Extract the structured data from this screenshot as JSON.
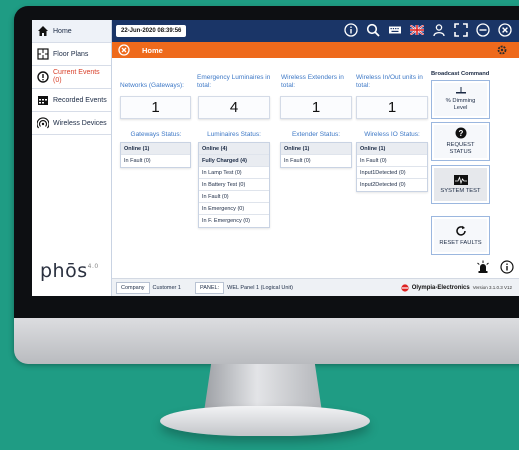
{
  "sidebar": {
    "items": [
      {
        "label": "Home",
        "icon": "home-icon"
      },
      {
        "label": "Floor Plans",
        "icon": "floor-plan-icon"
      },
      {
        "label": "Current Events",
        "sub": "(0)",
        "icon": "alert-icon"
      },
      {
        "label": "Recorded Events",
        "icon": "calendar-icon"
      },
      {
        "label": "Wireless Devices",
        "icon": "wireless-icon"
      }
    ],
    "logo_text": "phōs",
    "logo_version": "4.0"
  },
  "topbar": {
    "datetime": "22-Jun-2020 08:39:56",
    "icons": [
      "info-icon",
      "search-icon",
      "keyboard-icon",
      "uk-flag-icon",
      "user-icon",
      "fullscreen-icon",
      "minus-icon",
      "close-icon"
    ]
  },
  "titlebar": {
    "title": "Home"
  },
  "summary": [
    {
      "label": "Networks (Gateways):",
      "value": "1"
    },
    {
      "label": "Emergency Luminaires in total:",
      "value": "4"
    },
    {
      "label": "Wireless Extenders in total:",
      "value": "1"
    },
    {
      "label": "Wireless In/Out units in total:",
      "value": "1"
    }
  ],
  "status": {
    "gateways": {
      "title": "Gateways Status:",
      "rows": [
        "Online  (1)",
        "In Fault  (0)"
      ]
    },
    "luminaires": {
      "title": "Luminaires Status:",
      "rows": [
        "Online  (4)",
        "Fully Charged  (4)",
        "In Lamp Test  (0)",
        "In Battery Test  (0)",
        "In Fault  (0)",
        "In Emergency  (0)",
        "In F. Emergency  (0)"
      ]
    },
    "extender": {
      "title": "Extender Status:",
      "rows": [
        "Online  (1)",
        "In Fault  (0)"
      ]
    },
    "wireless_io": {
      "title": "Wireless IO Status:",
      "rows": [
        "Online  (1)",
        "In Fault  (0)",
        "Input1Detected  (0)",
        "Input2Detected  (0)"
      ]
    }
  },
  "broadcast": {
    "title": "Broadcast Command",
    "dimming": {
      "line1": "% Dimming",
      "line2": "Level"
    },
    "request": {
      "line1": "REQUEST",
      "line2": "STATUS"
    },
    "system_test": "SYSTEM TEST",
    "reset_faults": "RESET FAULTS"
  },
  "footer": {
    "company_label": "Company",
    "company_value": "Customer 1",
    "panel_label": "PANEL:",
    "panel_value": "WEL Panel 1 (Logical Unit)",
    "brand": "Olympia-Electronics",
    "version": "Version 3.1.0.3 V12"
  },
  "colors": {
    "background": "#1f9c84",
    "topbar": "#1a3567",
    "accent_orange": "#ee6a1c",
    "link_blue": "#3d78c6"
  }
}
